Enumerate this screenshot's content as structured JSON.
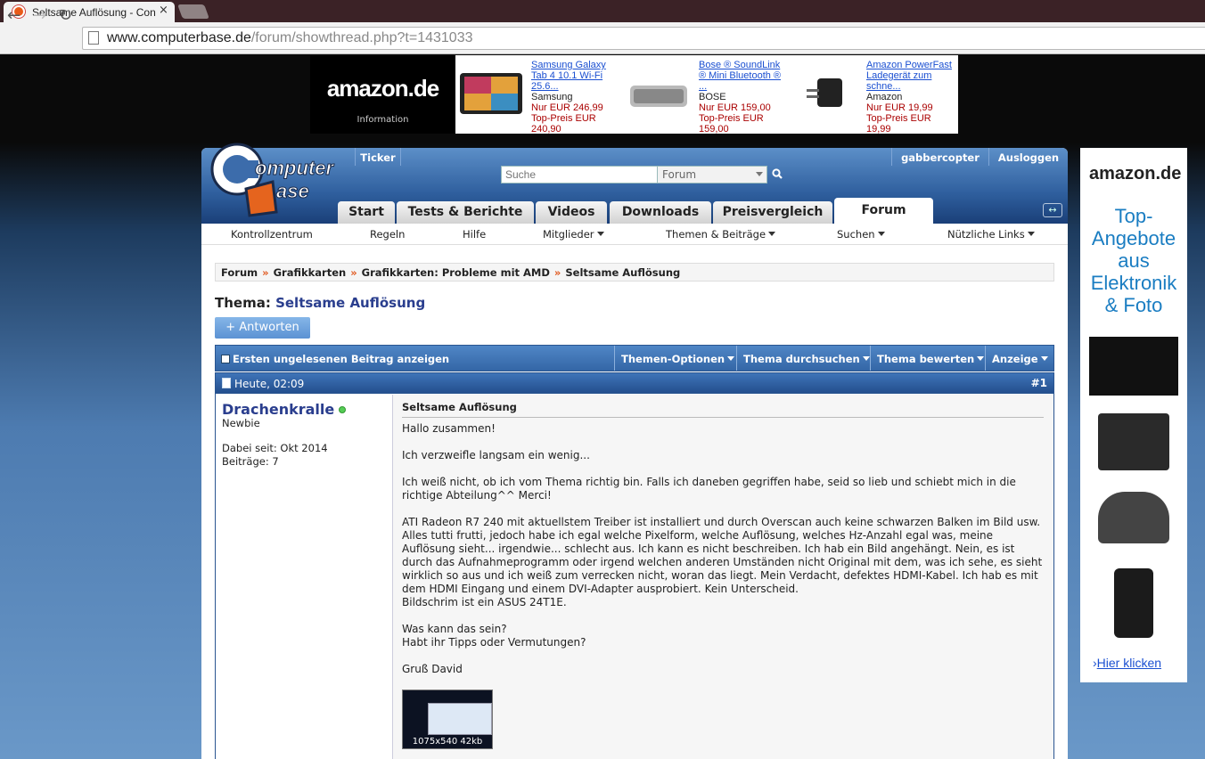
{
  "browser": {
    "tab_title": "Seltsame Auflösung - Con",
    "tab_close": "×",
    "url_domain": "www.computerbase.de",
    "url_path": "/forum/showthread.php?t=1431033"
  },
  "top_ad": {
    "logo": "amazon.de",
    "info": "Information",
    "products": [
      {
        "name": "Samsung Galaxy Tab 4 10.1 Wi-Fi 25.6...",
        "brand": "Samsung",
        "price": "Nur EUR 246,99",
        "top": "Top-Preis EUR 240,90"
      },
      {
        "name": "Bose ® SoundLink ® Mini Bluetooth ® ...",
        "brand": "BOSE",
        "price": "Nur EUR 159,00",
        "top": "Top-Preis EUR 159,00"
      },
      {
        "name": "Amazon PowerFast Ladegerät zum schne...",
        "brand": "Amazon",
        "price": "Nur EUR 19,99",
        "top": "Top-Preis EUR 19,99"
      }
    ]
  },
  "side_ad": {
    "logo": "amazon.de",
    "headline_1": "Top-",
    "headline_2": "Angebote",
    "headline_3": "aus",
    "headline_4": "Elektronik",
    "headline_5": "& Foto",
    "link": "Hier klicken"
  },
  "header": {
    "ticker": "Ticker",
    "user": "gabbercopter",
    "logout": "Ausloggen",
    "search_placeholder": "Suche",
    "search_scope": "Forum",
    "logo_line1": "Computer",
    "logo_line2": "Base"
  },
  "main_tabs": [
    "Start",
    "Tests & Berichte",
    "Videos",
    "Downloads",
    "Preisvergleich",
    "Forum"
  ],
  "subnav": [
    "Kontrollzentrum",
    "Regeln",
    "Hilfe",
    "Mitglieder",
    "Themen & Beiträge",
    "Suchen",
    "Nützliche Links"
  ],
  "breadcrumb": [
    "Forum",
    "Grafikkarten",
    "Grafikkarten: Probleme mit AMD",
    "Seltsame Auflösung"
  ],
  "breadcrumb_sep": "»",
  "thread": {
    "label": "Thema:",
    "title": "Seltsame Auflösung",
    "reply_button": "+ Antworten"
  },
  "toolbar": {
    "first_unread": "Ersten ungelesenen Beitrag anzeigen",
    "options": [
      "Themen-Optionen",
      "Thema durchsuchen",
      "Thema bewerten",
      "Anzeige"
    ]
  },
  "post": {
    "date": "Heute, 02:09",
    "number": "#1",
    "username": "Drachenkralle",
    "rank": "Newbie",
    "joined": "Dabei seit: Okt 2014",
    "posts": "Beiträge: 7",
    "title": "Seltsame Auflösung",
    "body": "Hallo zusammen!\n\nIch verzweifle langsam ein wenig...\n\nIch weiß nicht, ob ich vom Thema richtig bin. Falls ich daneben gegriffen habe, seid so lieb und schiebt mich in die richtige Abteilung^^ Merci!\n\nATI Radeon R7 240 mit aktuellstem Treiber ist installiert und durch Overscan auch keine schwarzen Balken im Bild usw. Alles tutti frutti, jedoch habe ich egal welche Pixelform, welche Auflösung, welches Hz-Anzahl egal was, meine Auflösung sieht... irgendwie... schlecht aus. Ich kann es nicht beschreiben. Ich hab ein Bild angehängt. Nein, es ist durch das Aufnahmeprogramm oder irgend welchen anderen Umständen nicht Original mit dem, was ich sehe, es sieht wirklich so aus und ich weiß zum verrecken nicht, woran das liegt. Mein Verdacht, defektes HDMI-Kabel. Ich hab es mit dem HDMI Eingang und einem DVI-Adapter ausprobiert. Kein Unterscheid.\nBildschrim ist ein ASUS 24T1E.\n\nWas kann das sein?\nHabt ihr Tipps oder Vermutungen?\n\nGruß David",
    "attachment_caption": "1075x540 42kb"
  }
}
